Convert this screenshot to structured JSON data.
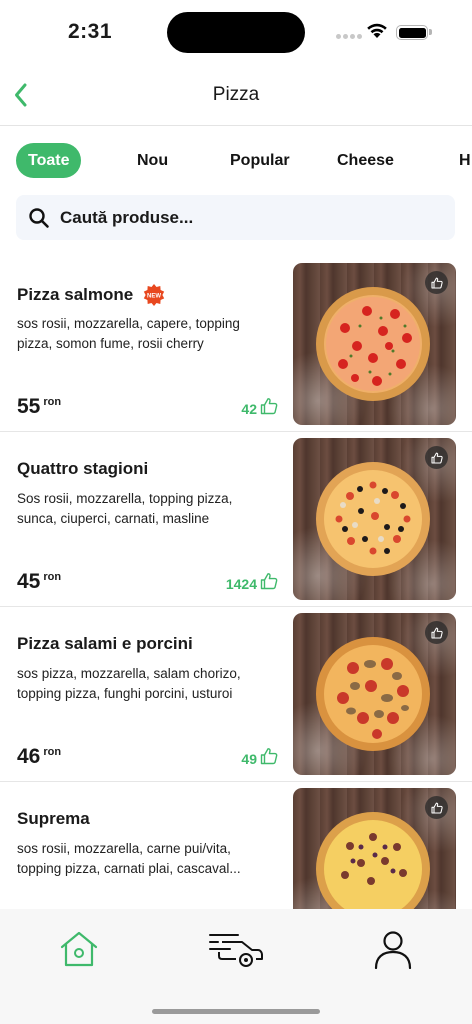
{
  "status_bar": {
    "time": "2:31"
  },
  "nav": {
    "title": "Pizza",
    "back_icon": "chevron-left-icon"
  },
  "tabs": [
    {
      "label": "Toate",
      "active": true
    },
    {
      "label": "Nou",
      "active": false
    },
    {
      "label": "Popular",
      "active": false
    },
    {
      "label": "Cheese",
      "active": false
    },
    {
      "label": "H",
      "active": false
    }
  ],
  "search": {
    "placeholder": "Caută produse...",
    "icon": "search-icon"
  },
  "products": [
    {
      "name": "Pizza salmone",
      "badge": "NEW",
      "description": "sos rosii, mozzarella, capere, topping pizza, somon fume, rosii cherry",
      "price": "55",
      "currency": "ron",
      "likes": "42"
    },
    {
      "name": "Quattro stagioni",
      "badge": "",
      "description": "Sos rosii, mozzarella, topping pizza, sunca, ciuperci, carnati, masline",
      "price": "45",
      "currency": "ron",
      "likes": "1424"
    },
    {
      "name": "Pizza salami e porcini",
      "badge": "",
      "description": "sos pizza, mozzarella, salam chorizo, topping pizza, funghi porcini, usturoi",
      "price": "46",
      "currency": "ron",
      "likes": "49"
    },
    {
      "name": "Suprema",
      "badge": "",
      "description": "sos rosii, mozzarella, carne pui/vita, topping pizza, carnati plai, cascaval...",
      "price": "",
      "currency": "",
      "likes": ""
    }
  ],
  "tab_bar": {
    "icons": [
      "home-icon",
      "delivery-car-icon",
      "profile-icon"
    ]
  },
  "colors": {
    "accent": "#3fb96b",
    "badge": "#e8481f",
    "text": "#1a1a1a"
  }
}
